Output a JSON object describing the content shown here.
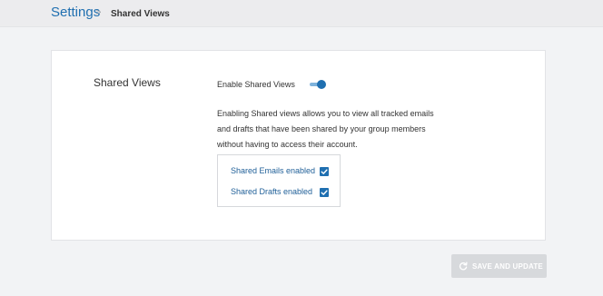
{
  "breadcrumb": {
    "root": "Settings",
    "separator": ">",
    "current": "Shared Views"
  },
  "section": {
    "title": "Shared Views"
  },
  "toggle": {
    "label": "Enable Shared Views",
    "enabled": true
  },
  "description": {
    "lines": [
      "Enabling Shared views allows you to view all tracked emails",
      "and drafts that have been shared by your group members",
      "without having to access their account."
    ]
  },
  "options": [
    {
      "label": "Shared Emails enabled",
      "checked": true
    },
    {
      "label": "Shared Drafts enabled",
      "checked": true
    }
  ],
  "save_button": {
    "label": "SAVE AND UPDATE",
    "icon": "refresh-icon",
    "disabled": true
  },
  "colors": {
    "accent": "#1f6fb0",
    "page_bg": "#f2f3f5",
    "button_disabled": "#d7d9dc"
  }
}
